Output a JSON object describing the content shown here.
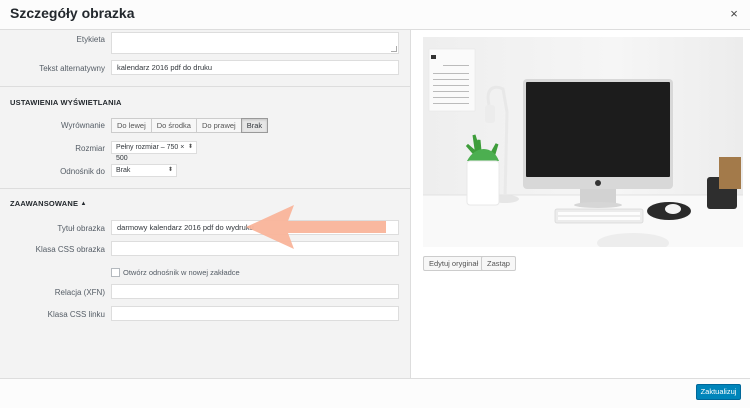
{
  "modal": {
    "title": "Szczegóły obrazka",
    "close_icon": "×"
  },
  "form": {
    "caption_label": "Etykieta",
    "caption_value": "",
    "alt_label": "Tekst alternatywny",
    "alt_value": "kalendarz 2016 pdf do druku",
    "display_section": "USTAWIENIA WYŚWIETLANIA",
    "align_label": "Wyrównanie",
    "align_options": [
      "Do lewej",
      "Do środka",
      "Do prawej",
      "Brak"
    ],
    "align_selected": "Brak",
    "size_label": "Rozmiar",
    "size_value": "Pełny rozmiar – 750 × 500",
    "link_label": "Odnośnik do",
    "link_value": "Brak",
    "advanced_section": "ZAAWANSOWANE",
    "advanced_icon": "▲",
    "img_title_label": "Tytuł obrazka",
    "img_title_value": "darmowy kalendarz 2016 pdf do wydruku",
    "img_css_label": "Klasa CSS obrazka",
    "img_css_value": "",
    "newtab_label": "Otwórz odnośnik w nowej zakładce",
    "rel_label": "Relacja (XFN)",
    "rel_value": "",
    "link_css_label": "Klasa CSS linku",
    "link_css_value": ""
  },
  "image_actions": {
    "edit_original": "Edytuj oryginał",
    "replace": "Zastąp"
  },
  "footer": {
    "update_button": "Zaktualizuj"
  },
  "colors": {
    "primary": "#0085ba",
    "arrow": "#f9b49a"
  }
}
